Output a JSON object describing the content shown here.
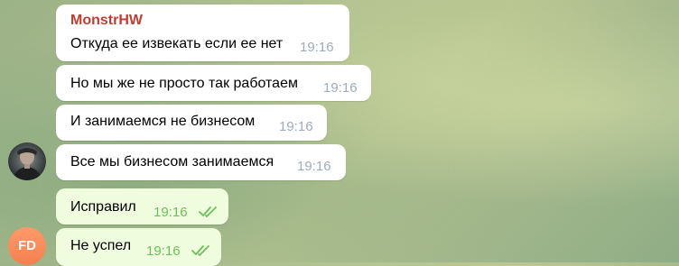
{
  "messages": [
    {
      "sender": "MonstrHW",
      "text": "Откуда ее извекать если ее нет",
      "time": "19:16",
      "direction": "incoming"
    },
    {
      "text": "Но мы же не просто так работаем",
      "time": "19:16",
      "direction": "incoming"
    },
    {
      "text": "И занимаемся не бизнесом",
      "time": "19:16",
      "direction": "incoming"
    },
    {
      "text": "Все мы бизнесом занимаемся",
      "time": "19:16",
      "direction": "incoming"
    },
    {
      "text": "Исправил",
      "time": "19:16",
      "direction": "outgoing",
      "status": "read"
    },
    {
      "text": "Не успел",
      "time": "19:16",
      "direction": "outgoing",
      "status": "read"
    }
  ],
  "avatars": {
    "incoming_icon": "user-photo-icon",
    "outgoing_initials": "FD"
  },
  "colors": {
    "sender_name": "#c03d33",
    "incoming_bubble": "#ffffff",
    "outgoing_bubble": "#effdde",
    "incoming_time": "#a0acb6",
    "outgoing_time": "#6cbf5a",
    "outgoing_avatar": "#f57f4f"
  }
}
